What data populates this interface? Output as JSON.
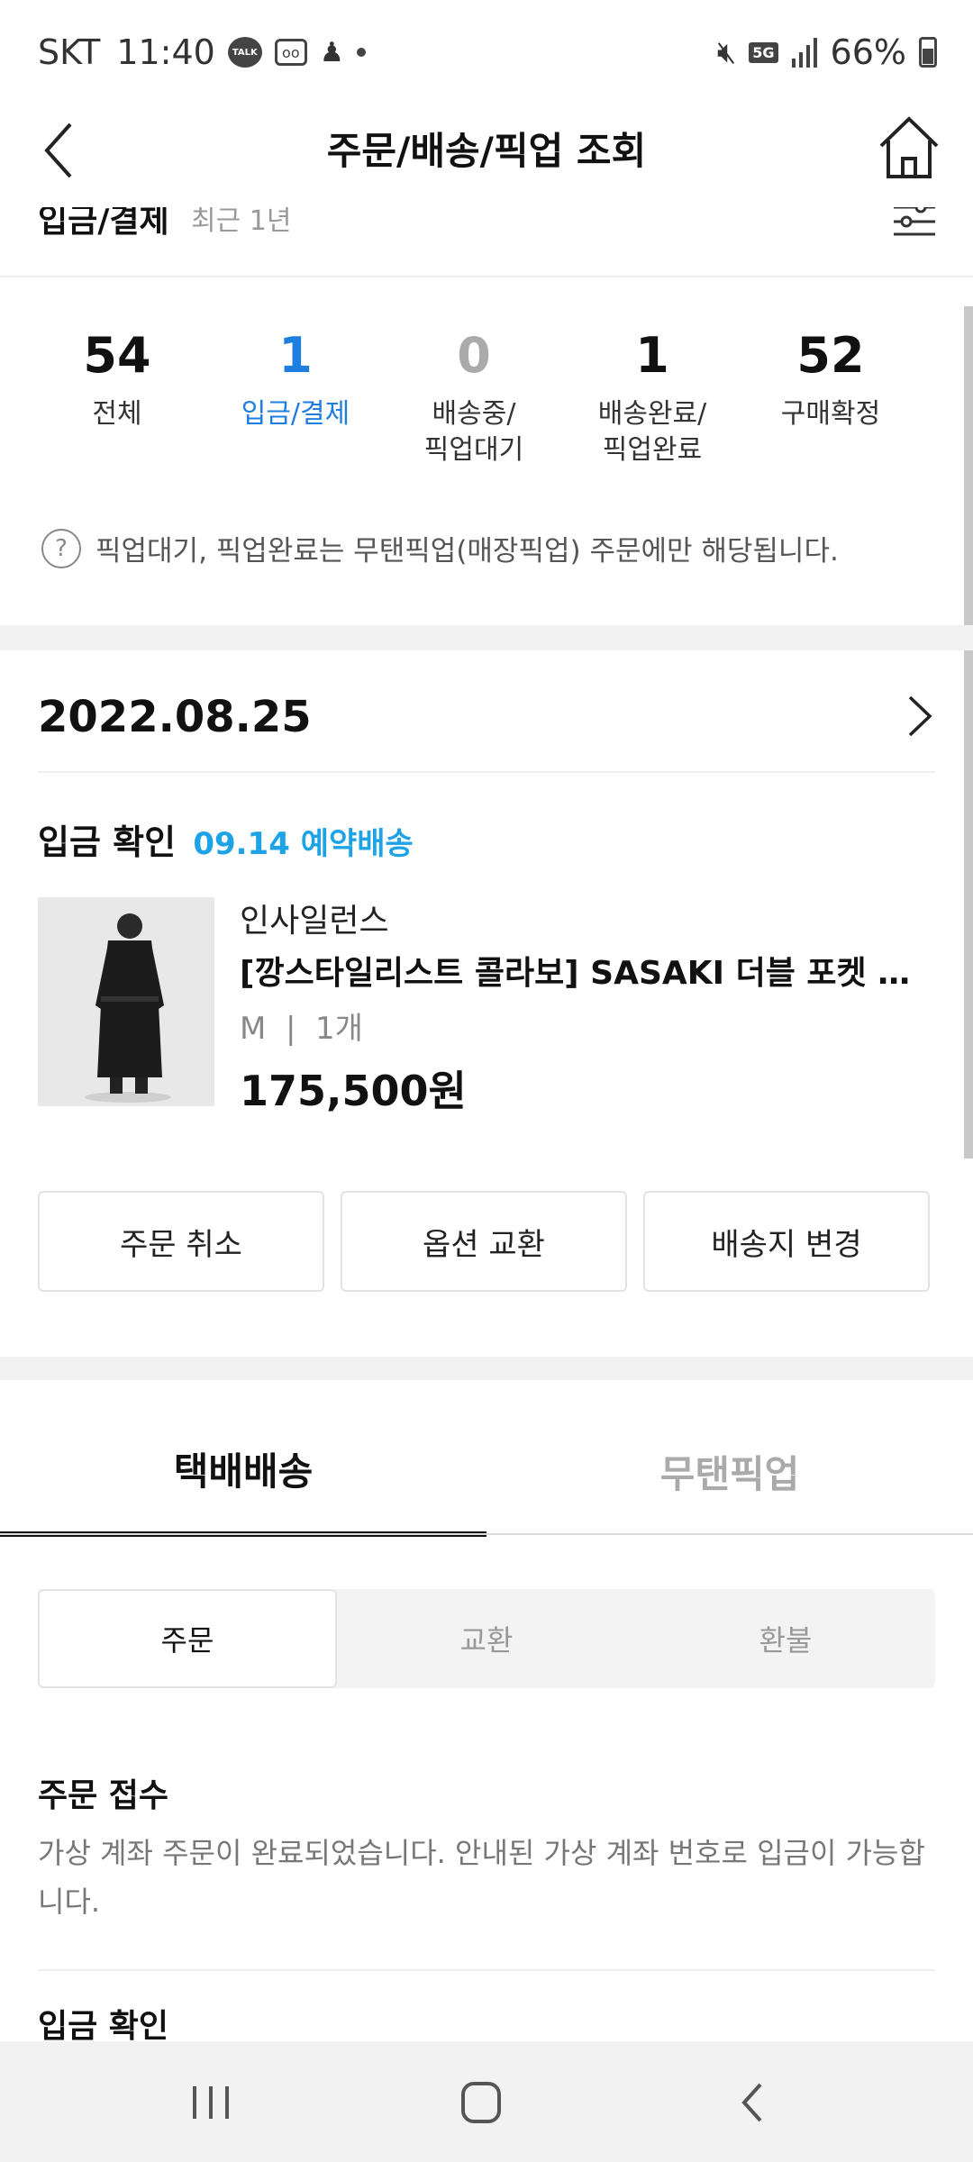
{
  "status_bar": {
    "carrier": "SKT",
    "time": "11:40",
    "talk_label": "TALK",
    "network": "5G",
    "battery": "66%"
  },
  "header": {
    "title": "주문/배송/픽업 조회"
  },
  "filter": {
    "title": "입금/결제",
    "range": "최근 1년"
  },
  "summary": [
    {
      "count": "54",
      "label": "전체"
    },
    {
      "count": "1",
      "label": "입금/결제"
    },
    {
      "count": "0",
      "label": "배송중/\n픽업대기"
    },
    {
      "count": "1",
      "label": "배송완료/\n픽업완료"
    },
    {
      "count": "52",
      "label": "구매확정"
    }
  ],
  "notice": {
    "icon": "?",
    "text": "픽업대기, 픽업완료는 무탠픽업(매장픽업) 주문에만 해당됩니다."
  },
  "order": {
    "date": "2022.08.25",
    "status": "입금 확인",
    "delivery": "09.14 예약배송",
    "product": {
      "brand": "인사일런스",
      "name": "[깡스타일리스트 콜라보] SASAKI 더블 포켓 트렌치 코트",
      "option": "M  |  1개",
      "price": "175,500원"
    },
    "actions": {
      "cancel": "주문 취소",
      "exchange_option": "옵션 교환",
      "change_address": "배송지 변경"
    }
  },
  "tabs": {
    "delivery": "택배배송",
    "pickup": "무탠픽업"
  },
  "segments": {
    "order": "주문",
    "exchange": "교환",
    "refund": "환불"
  },
  "steps": {
    "received_title": "주문 접수",
    "received_desc": "가상 계좌 주문이 완료되었습니다. 안내된 가상 계좌 번호로 입금이 가능합니다.",
    "paid_title": "입금 확인"
  },
  "colors": {
    "accent_blue": "#1f7fe0",
    "delivery_blue": "#1ea3e6"
  }
}
